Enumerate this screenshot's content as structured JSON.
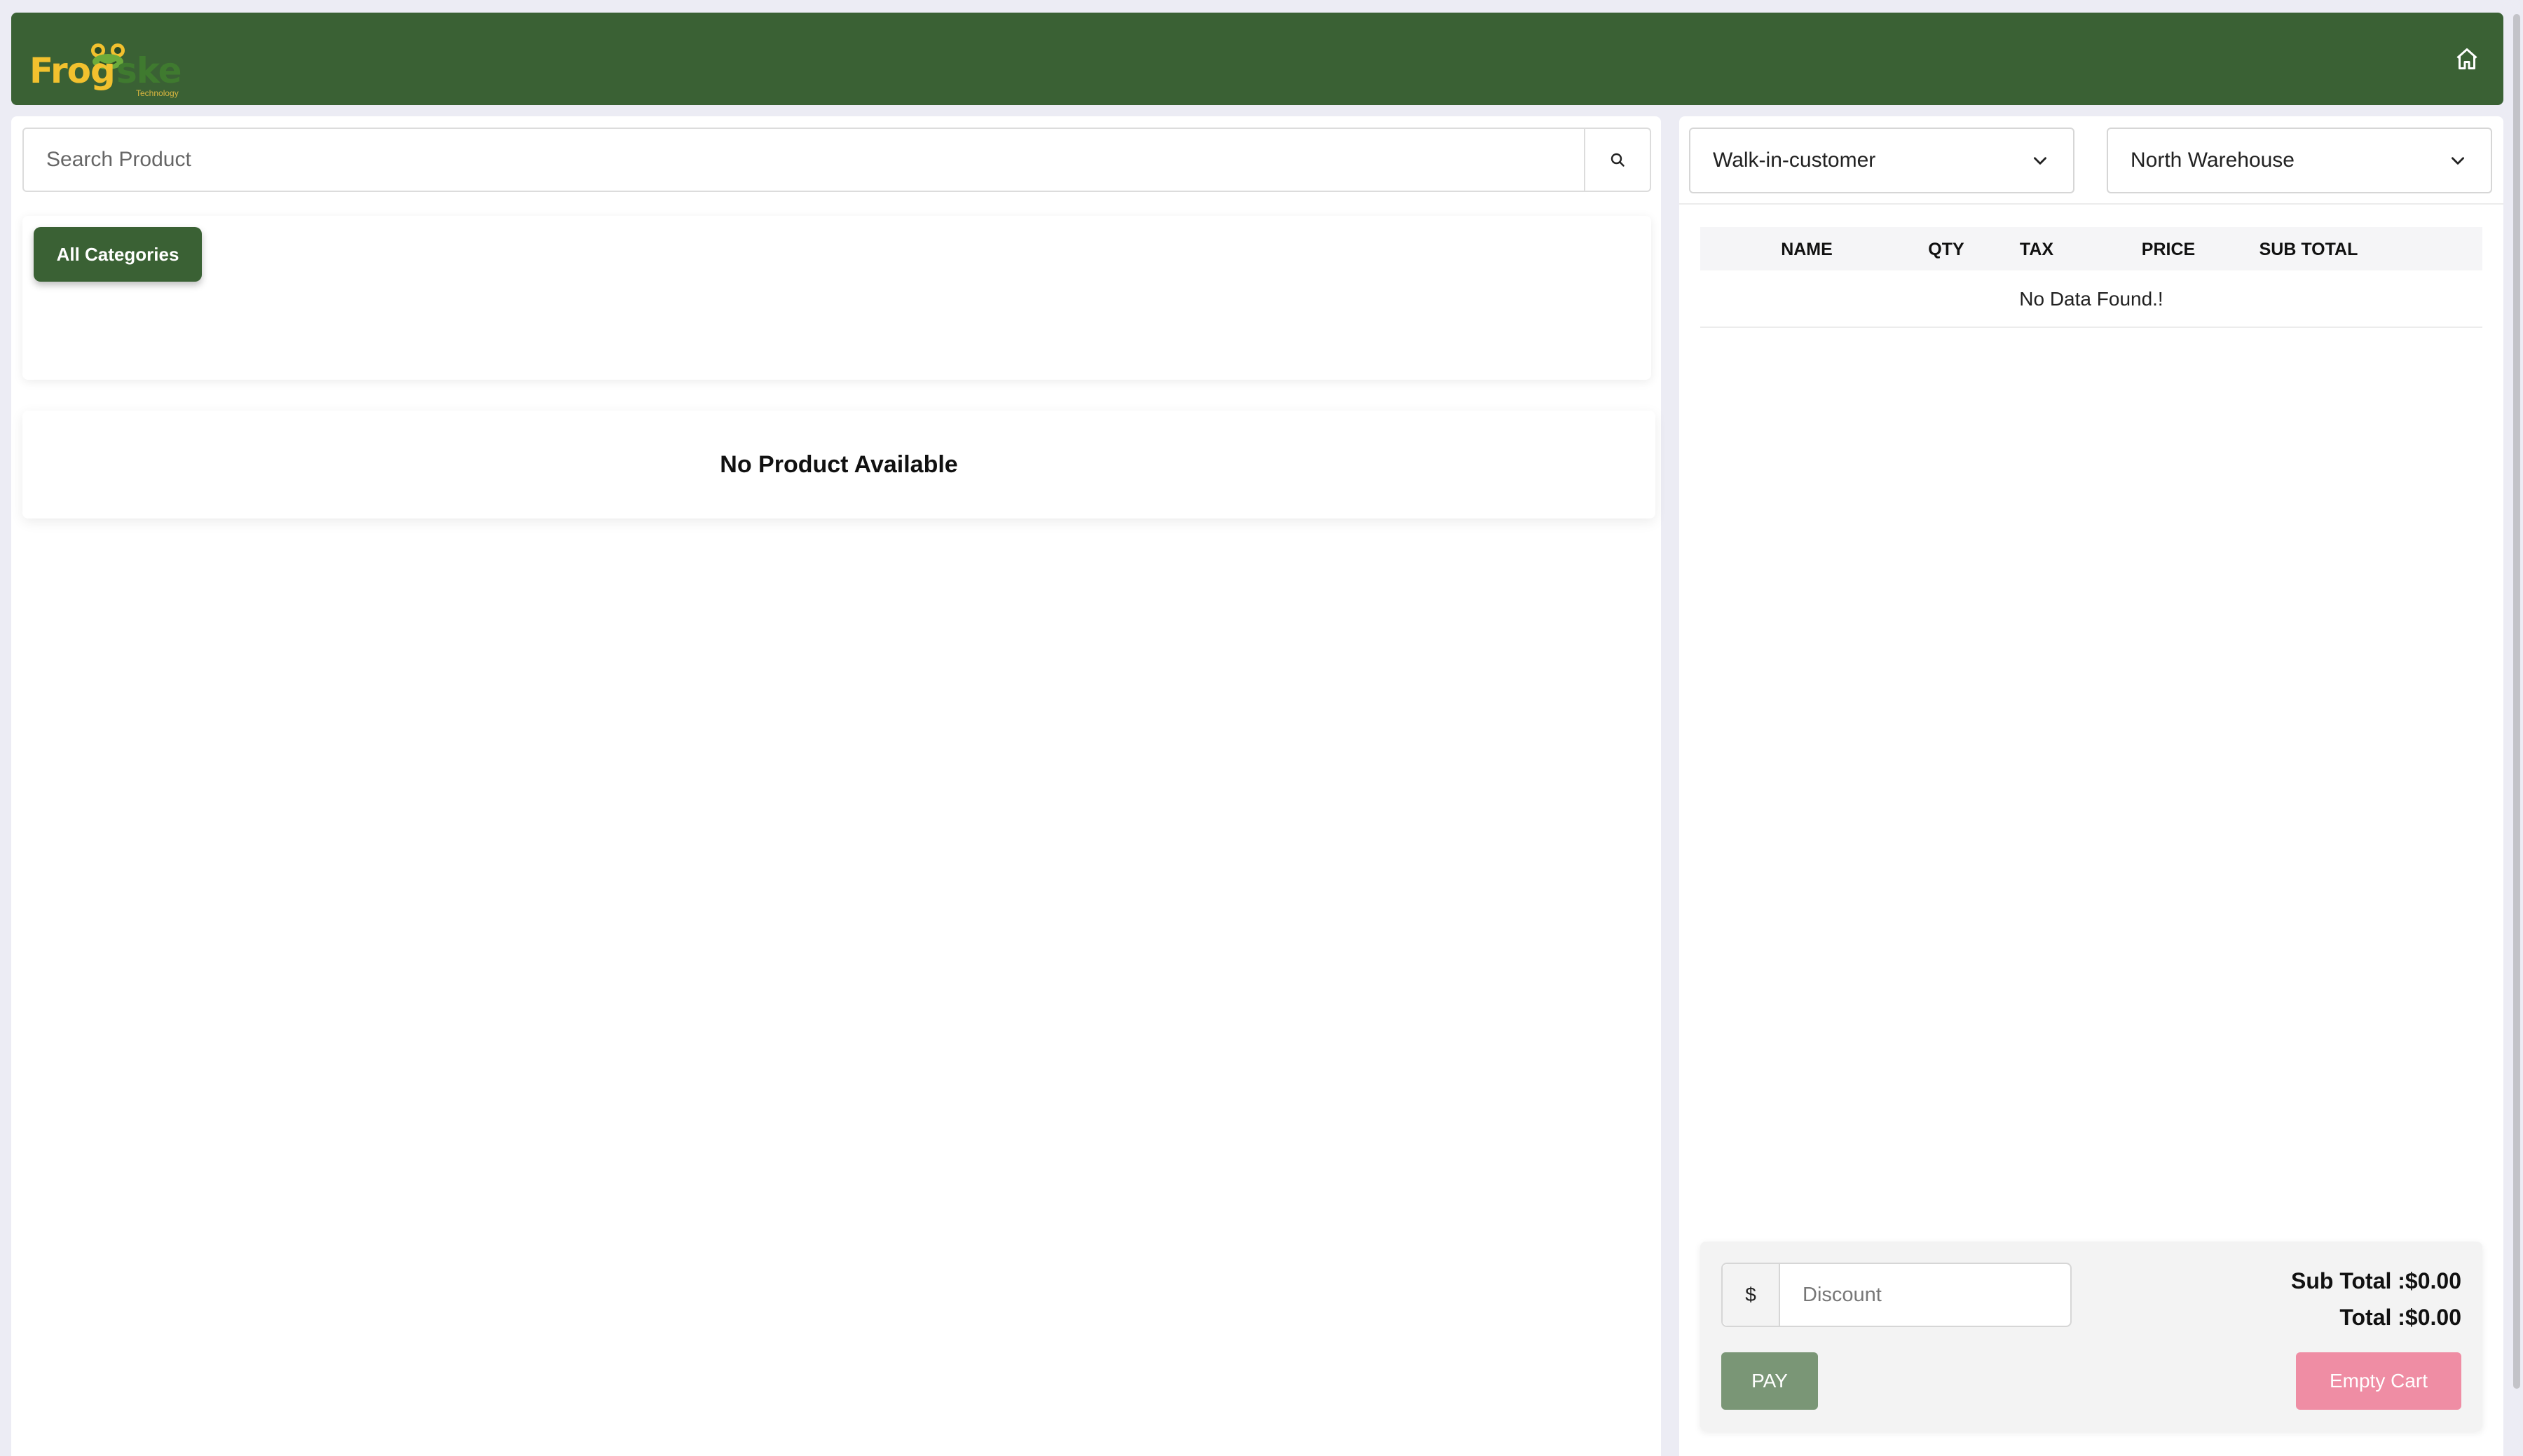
{
  "header": {
    "logo_primary": "Frog",
    "logo_secondary": "ske",
    "logo_tagline": "Technology",
    "home_icon": "home-icon"
  },
  "products": {
    "search_placeholder": "Search Product",
    "search_icon": "search-icon",
    "categories": [
      {
        "label": "All Categories",
        "active": true
      }
    ],
    "empty_message": "No Product Available"
  },
  "cart": {
    "customer_select": "Walk-in-customer",
    "warehouse_select": "North Warehouse",
    "columns": [
      "NAME",
      "QTY",
      "TAX",
      "PRICE",
      "SUB TOTAL"
    ],
    "empty_message": "No Data Found.!",
    "discount_prefix": "$",
    "discount_placeholder": "Discount",
    "sub_total": "Sub Total :$0.00",
    "total": "Total :$0.00",
    "pay_label": "PAY",
    "empty_cart_label": "Empty Cart"
  },
  "colors": {
    "brand_green": "#3a6134",
    "pay_green": "#7a9676",
    "empty_cart_pink": "#ef8da4",
    "logo_yellow": "#f2c12e"
  }
}
